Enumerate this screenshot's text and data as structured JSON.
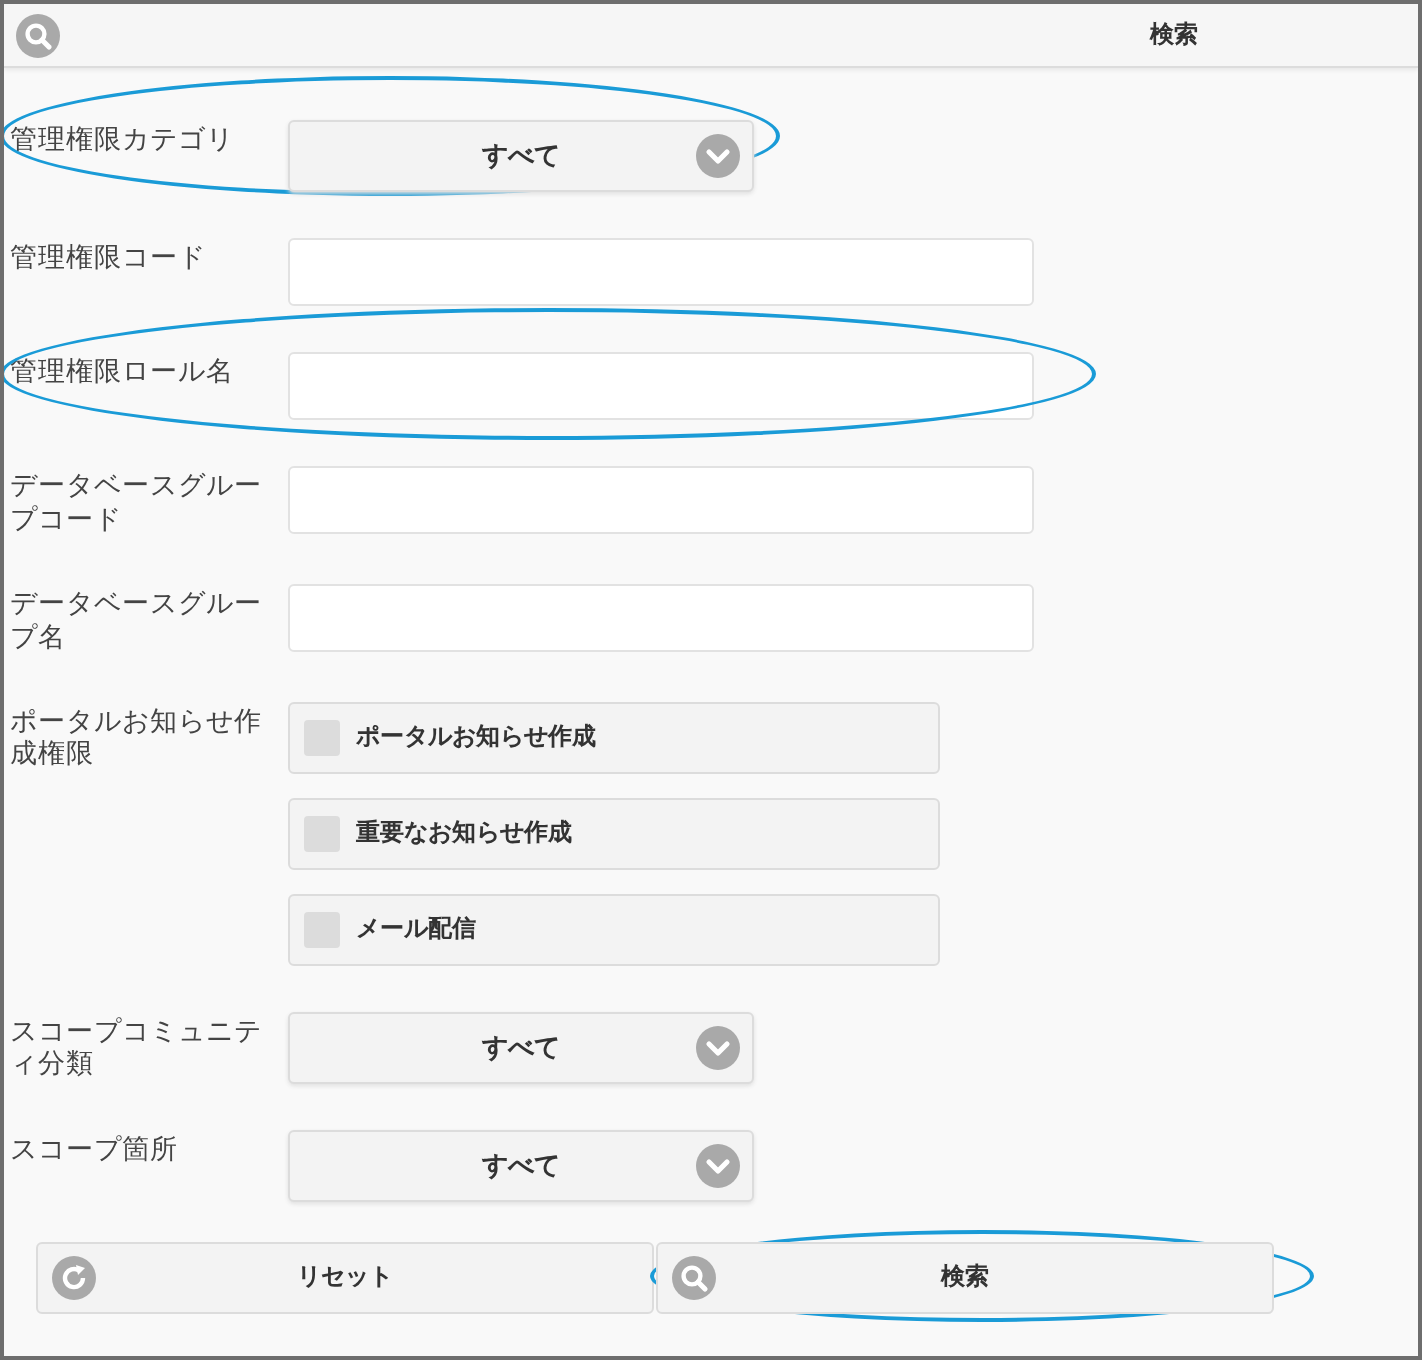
{
  "header": {
    "title": "検索"
  },
  "fields": [
    {
      "kind": "select",
      "label": "管理権限カテゴリ",
      "value": "すべて",
      "highlighted": true
    },
    {
      "kind": "text",
      "label": "管理権限コード",
      "highlighted": false
    },
    {
      "kind": "text",
      "label": "管理権限ロール名",
      "highlighted": true
    },
    {
      "kind": "text",
      "label": "データベースグループコード",
      "highlighted": false
    },
    {
      "kind": "text",
      "label": "データベースグループ名",
      "highlighted": false
    },
    {
      "kind": "checkboxes",
      "label": "ポータルお知らせ作成権限",
      "highlighted": false,
      "options": [
        {
          "label": "ポータルお知らせ作成",
          "checked": false
        },
        {
          "label": "重要なお知らせ作成",
          "checked": false
        },
        {
          "label": "メール配信",
          "checked": false
        }
      ]
    },
    {
      "kind": "select",
      "label": "スコープコミュニティ分類",
      "value": "すべて",
      "highlighted": false
    },
    {
      "kind": "select",
      "label": "スコープ箇所",
      "value": "すべて",
      "highlighted": false
    }
  ],
  "buttons": [
    {
      "kind": "reset",
      "label": "リセット",
      "highlighted": false
    },
    {
      "kind": "search",
      "label": "検索",
      "highlighted": true
    }
  ]
}
